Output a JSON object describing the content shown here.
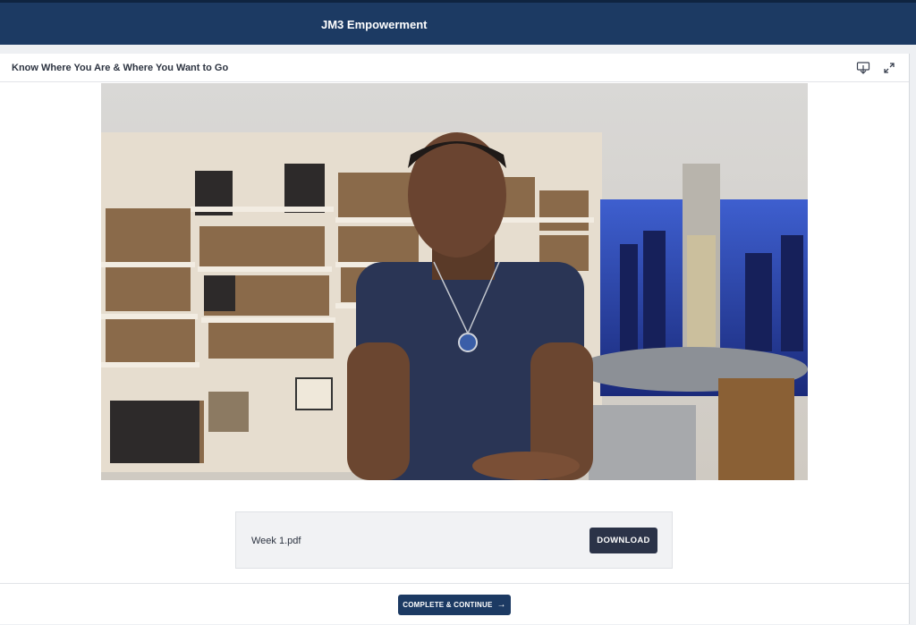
{
  "header": {
    "brand": "JM3 Empowerment"
  },
  "lesson": {
    "title": "Know Where You Are & Where You Want to Go",
    "icons": {
      "download": "download-icon",
      "fullscreen": "expand-icon"
    }
  },
  "attachment": {
    "file_name": "Week 1.pdf",
    "download_label": "DOWNLOAD"
  },
  "footer": {
    "complete_label": "COMPLETE & CONTINUE",
    "arrow_icon": "arrow-right-icon"
  },
  "colors": {
    "navy": "#1c3a63",
    "button_dark": "#2b3348",
    "panel": "#f1f2f4"
  }
}
